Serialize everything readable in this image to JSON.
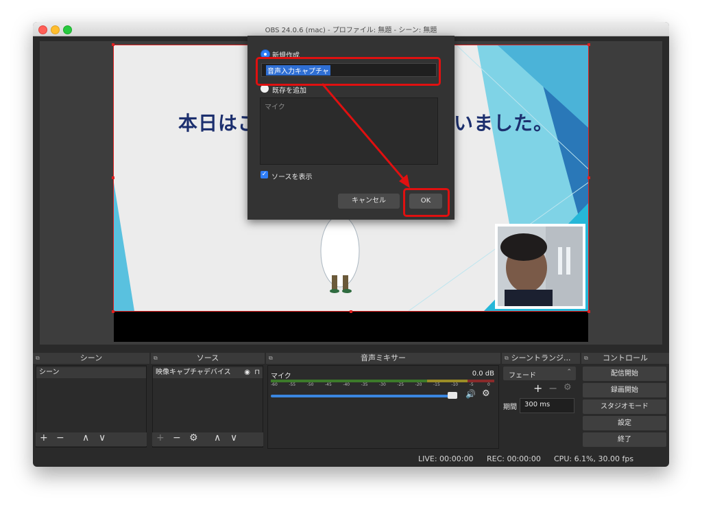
{
  "window": {
    "title": "OBS 24.0.6 (mac) - プロファイル: 無題 - シーン: 無題"
  },
  "preview": {
    "slide_text_left": "本日はご",
    "slide_text_right": "いました。"
  },
  "dialog": {
    "create_new_label": "新規作成",
    "name_value": "音声入力キャプチャ",
    "add_existing_label": "既存を追加",
    "existing_list_item": "マイク",
    "show_source_label": "ソースを表示",
    "cancel_label": "キャンセル",
    "ok_label": "OK"
  },
  "docks": {
    "scenes": {
      "title": "シーン",
      "items": [
        "シーン"
      ]
    },
    "sources": {
      "title": "ソース",
      "items": [
        "映像キャプチャデバイス"
      ]
    },
    "mixer": {
      "title": "音声ミキサー",
      "track_name": "マイク",
      "track_level": "0.0 dB",
      "volume": 1.0,
      "scale_labels": [
        "-60",
        "-55",
        "-50",
        "-45",
        "-40",
        "-35",
        "-30",
        "-25",
        "-20",
        "-15",
        "-10",
        "-5",
        "0"
      ]
    },
    "transitions": {
      "title": "シーントランジ...",
      "selected": "フェード",
      "duration_label": "期間",
      "duration_value": "300 ms"
    },
    "controls": {
      "title": "コントロール",
      "buttons": [
        "配信開始",
        "録画開始",
        "スタジオモード",
        "設定",
        "終了"
      ]
    }
  },
  "statusbar": {
    "live": "LIVE: 00:00:00",
    "rec": "REC: 00:00:00",
    "cpu": "CPU: 6.1%, 30.00 fps"
  },
  "colors": {
    "accent": "#2f6fd4",
    "annotation_red": "#e01010",
    "dialog_bg": "#333333",
    "panel_bg": "#2b2b2b"
  }
}
